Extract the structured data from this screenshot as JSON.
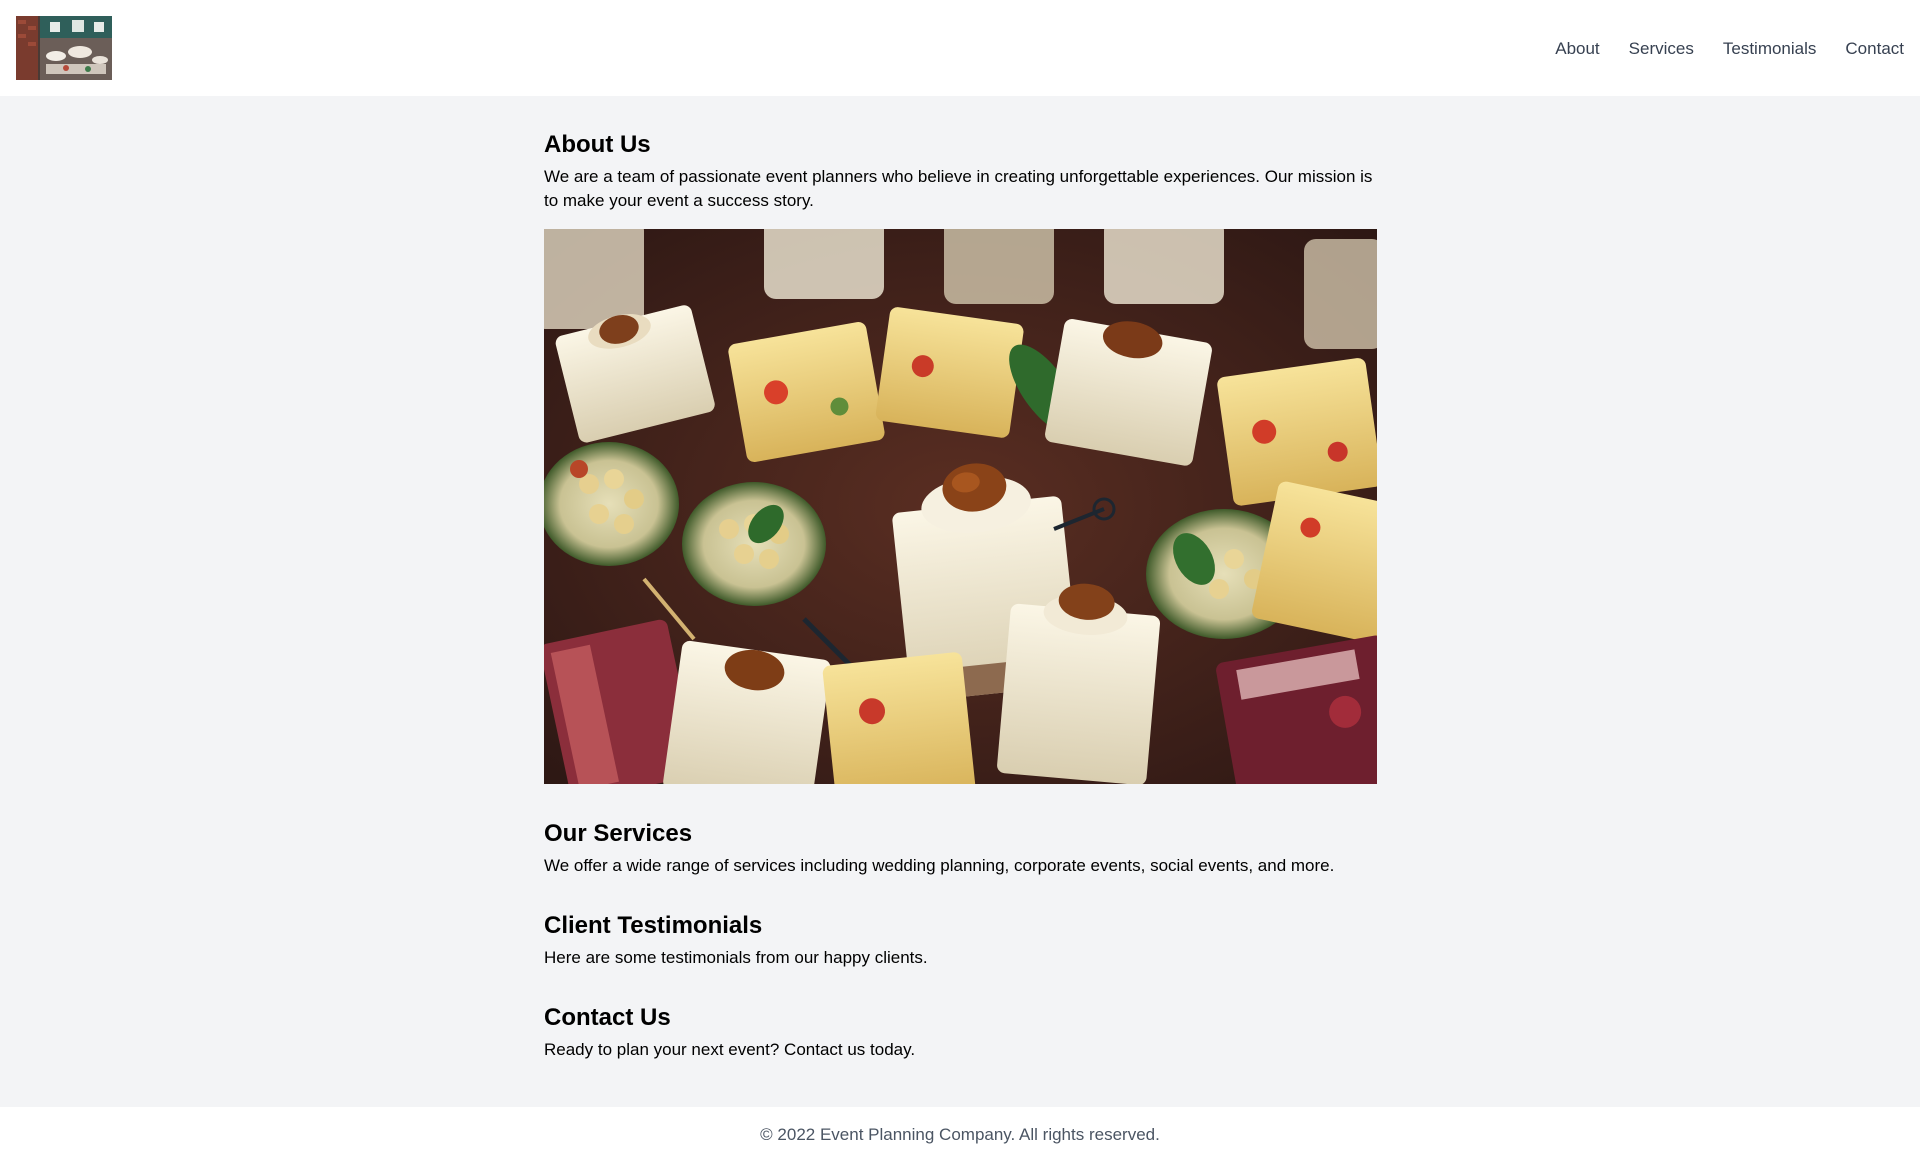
{
  "header": {
    "logo_alt": "event-buffet-photo",
    "nav": [
      {
        "label": "About"
      },
      {
        "label": "Services"
      },
      {
        "label": "Testimonials"
      },
      {
        "label": "Contact"
      }
    ]
  },
  "main": {
    "about": {
      "heading": "About Us",
      "body": "We are a team of passionate event planners who believe in creating unforgettable experiences. Our mission is to make your event a success story.",
      "image": "catering-appetizers-photo"
    },
    "services": {
      "heading": "Our Services",
      "body": "We offer a wide range of services including wedding planning, corporate events, social events, and more."
    },
    "testimonials": {
      "heading": "Client Testimonials",
      "body": "Here are some testimonials from our happy clients."
    },
    "contact": {
      "heading": "Contact Us",
      "body": "Ready to plan your next event? Contact us today."
    }
  },
  "footer": {
    "copyright": "© 2022 Event Planning Company. All rights reserved."
  },
  "colors": {
    "page_bg": "#f3f4f6",
    "header_bg": "#ffffff",
    "nav_text": "#374151",
    "footer_text": "#4b5563"
  }
}
